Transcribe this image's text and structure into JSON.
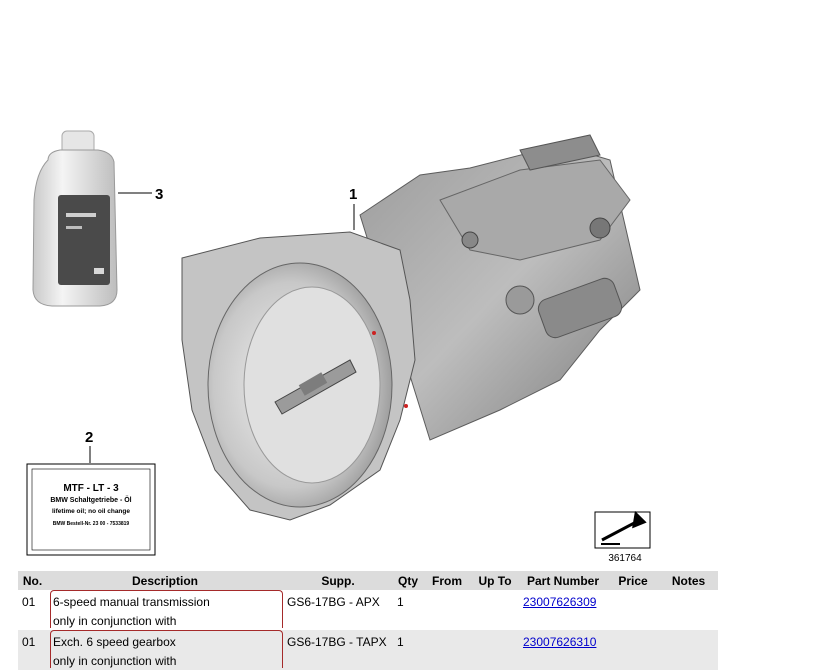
{
  "diagram": {
    "callouts": [
      "1",
      "2",
      "3"
    ],
    "oil_label": {
      "line1": "MTF - LT - 3",
      "line2": "BMW Schaltgetriebe - Öl",
      "line3": "lifetime oil; no oil change",
      "line4": "BMW Bestell-Nr. 23 00 - 7533819"
    },
    "reference_number": "361764"
  },
  "table": {
    "headers": {
      "no": "No.",
      "description": "Description",
      "supp": "Supp.",
      "qty": "Qty",
      "from": "From",
      "up_to": "Up To",
      "part_number": "Part Number",
      "price": "Price",
      "notes": "Notes"
    },
    "rows": [
      {
        "no": "01",
        "desc1": "6-speed manual transmission",
        "desc2": "only in conjunction with",
        "supp": "GS6-17BG - APX",
        "qty": "1",
        "from": "",
        "up_to": "",
        "part_number": "23007626309",
        "price": "",
        "notes": ""
      },
      {
        "no": "01",
        "desc1": "Exch. 6 speed gearbox",
        "desc2": "only in conjunction with",
        "supp": "GS6-17BG - TAPX",
        "qty": "1",
        "from": "",
        "up_to": "",
        "part_number": "23007626310",
        "price": "",
        "notes": ""
      }
    ]
  }
}
